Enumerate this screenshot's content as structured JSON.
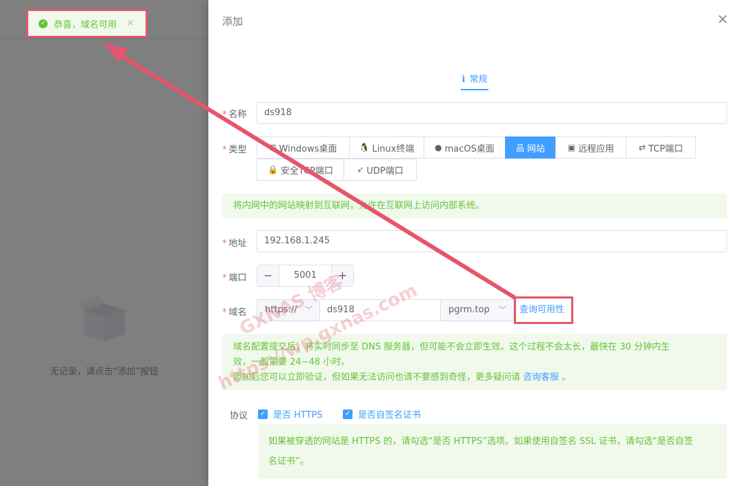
{
  "background": {
    "empty_text": "无记录，请点击“添加”按钮"
  },
  "toast": {
    "message": "恭喜，域名可用",
    "icon": "check-circle-icon",
    "close_icon": "close-icon"
  },
  "drawer": {
    "title": "添加",
    "tab_label": "常规"
  },
  "form": {
    "name": {
      "label": "名称",
      "value": "ds918"
    },
    "type": {
      "label": "类型",
      "options": [
        {
          "label": "Windows桌面",
          "icon": "windows-icon",
          "active": false
        },
        {
          "label": "Linux终端",
          "icon": "linux-icon",
          "active": false
        },
        {
          "label": "macOS桌面",
          "icon": "apple-icon",
          "active": false
        },
        {
          "label": "网站",
          "icon": "sitemap-icon",
          "active": true
        },
        {
          "label": "远程应用",
          "icon": "remote-app-icon",
          "active": false
        },
        {
          "label": "TCP端口",
          "icon": "exchange-icon",
          "active": false
        },
        {
          "label": "安全TCP端口",
          "icon": "lock-icon",
          "active": false
        },
        {
          "label": "UDP端口",
          "icon": "rocket-icon",
          "active": false
        }
      ]
    },
    "type_hint": "将内网中的网站映射到互联网，允许在互联网上访问内部系统。",
    "address": {
      "label": "地址",
      "value": "192.168.1.245"
    },
    "port": {
      "label": "端口",
      "value": "5001"
    },
    "domain": {
      "label": "域名",
      "protocol": "https://",
      "subdomain": "ds918",
      "root": "pgrm.top",
      "check_label": "查询可用性"
    },
    "domain_hint": {
      "line1": "域名配置提交后，将实时同步至 DNS 服务器，但可能不会立即生效。这个过程不会太长，最快在 30 分钟内生",
      "line2": "效，一般需要 24~48 小时。",
      "line3_a": "添加后您可以立即验证，但如果无法访问也请不要感到奇怪，更多疑问请",
      "line3_link": "咨询客服",
      "line3_b": "。"
    },
    "protocol": {
      "label": "协议",
      "https_label": "是否 HTTPS",
      "https_checked": true,
      "selfsigned_label": "是否自签名证书",
      "selfsigned_checked": true
    },
    "protocol_hint": {
      "line1": "如果被穿透的网站是 HTTPS 的，请勾选“是否 HTTPS”选项。如果使用自签名 SSL 证书，请勾选“是否自签",
      "line2": "名证书”。"
    }
  },
  "watermark": {
    "line1": "GXNAS 博客",
    "line2": "https://wp.gxnas.com"
  },
  "colors": {
    "primary": "#409eff",
    "success": "#67c23a",
    "success_bg": "#f0f9eb",
    "annotation": "#e5556b"
  }
}
